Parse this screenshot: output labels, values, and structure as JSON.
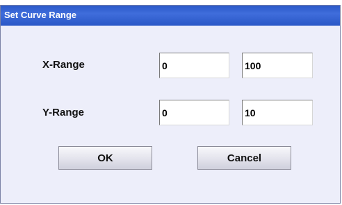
{
  "dialog": {
    "title": "Set Curve Range",
    "x_range": {
      "label": "X-Range",
      "min": "0",
      "max": "100"
    },
    "y_range": {
      "label": "Y-Range",
      "min": "0",
      "max": "10"
    },
    "ok_label": "OK",
    "cancel_label": "Cancel"
  }
}
